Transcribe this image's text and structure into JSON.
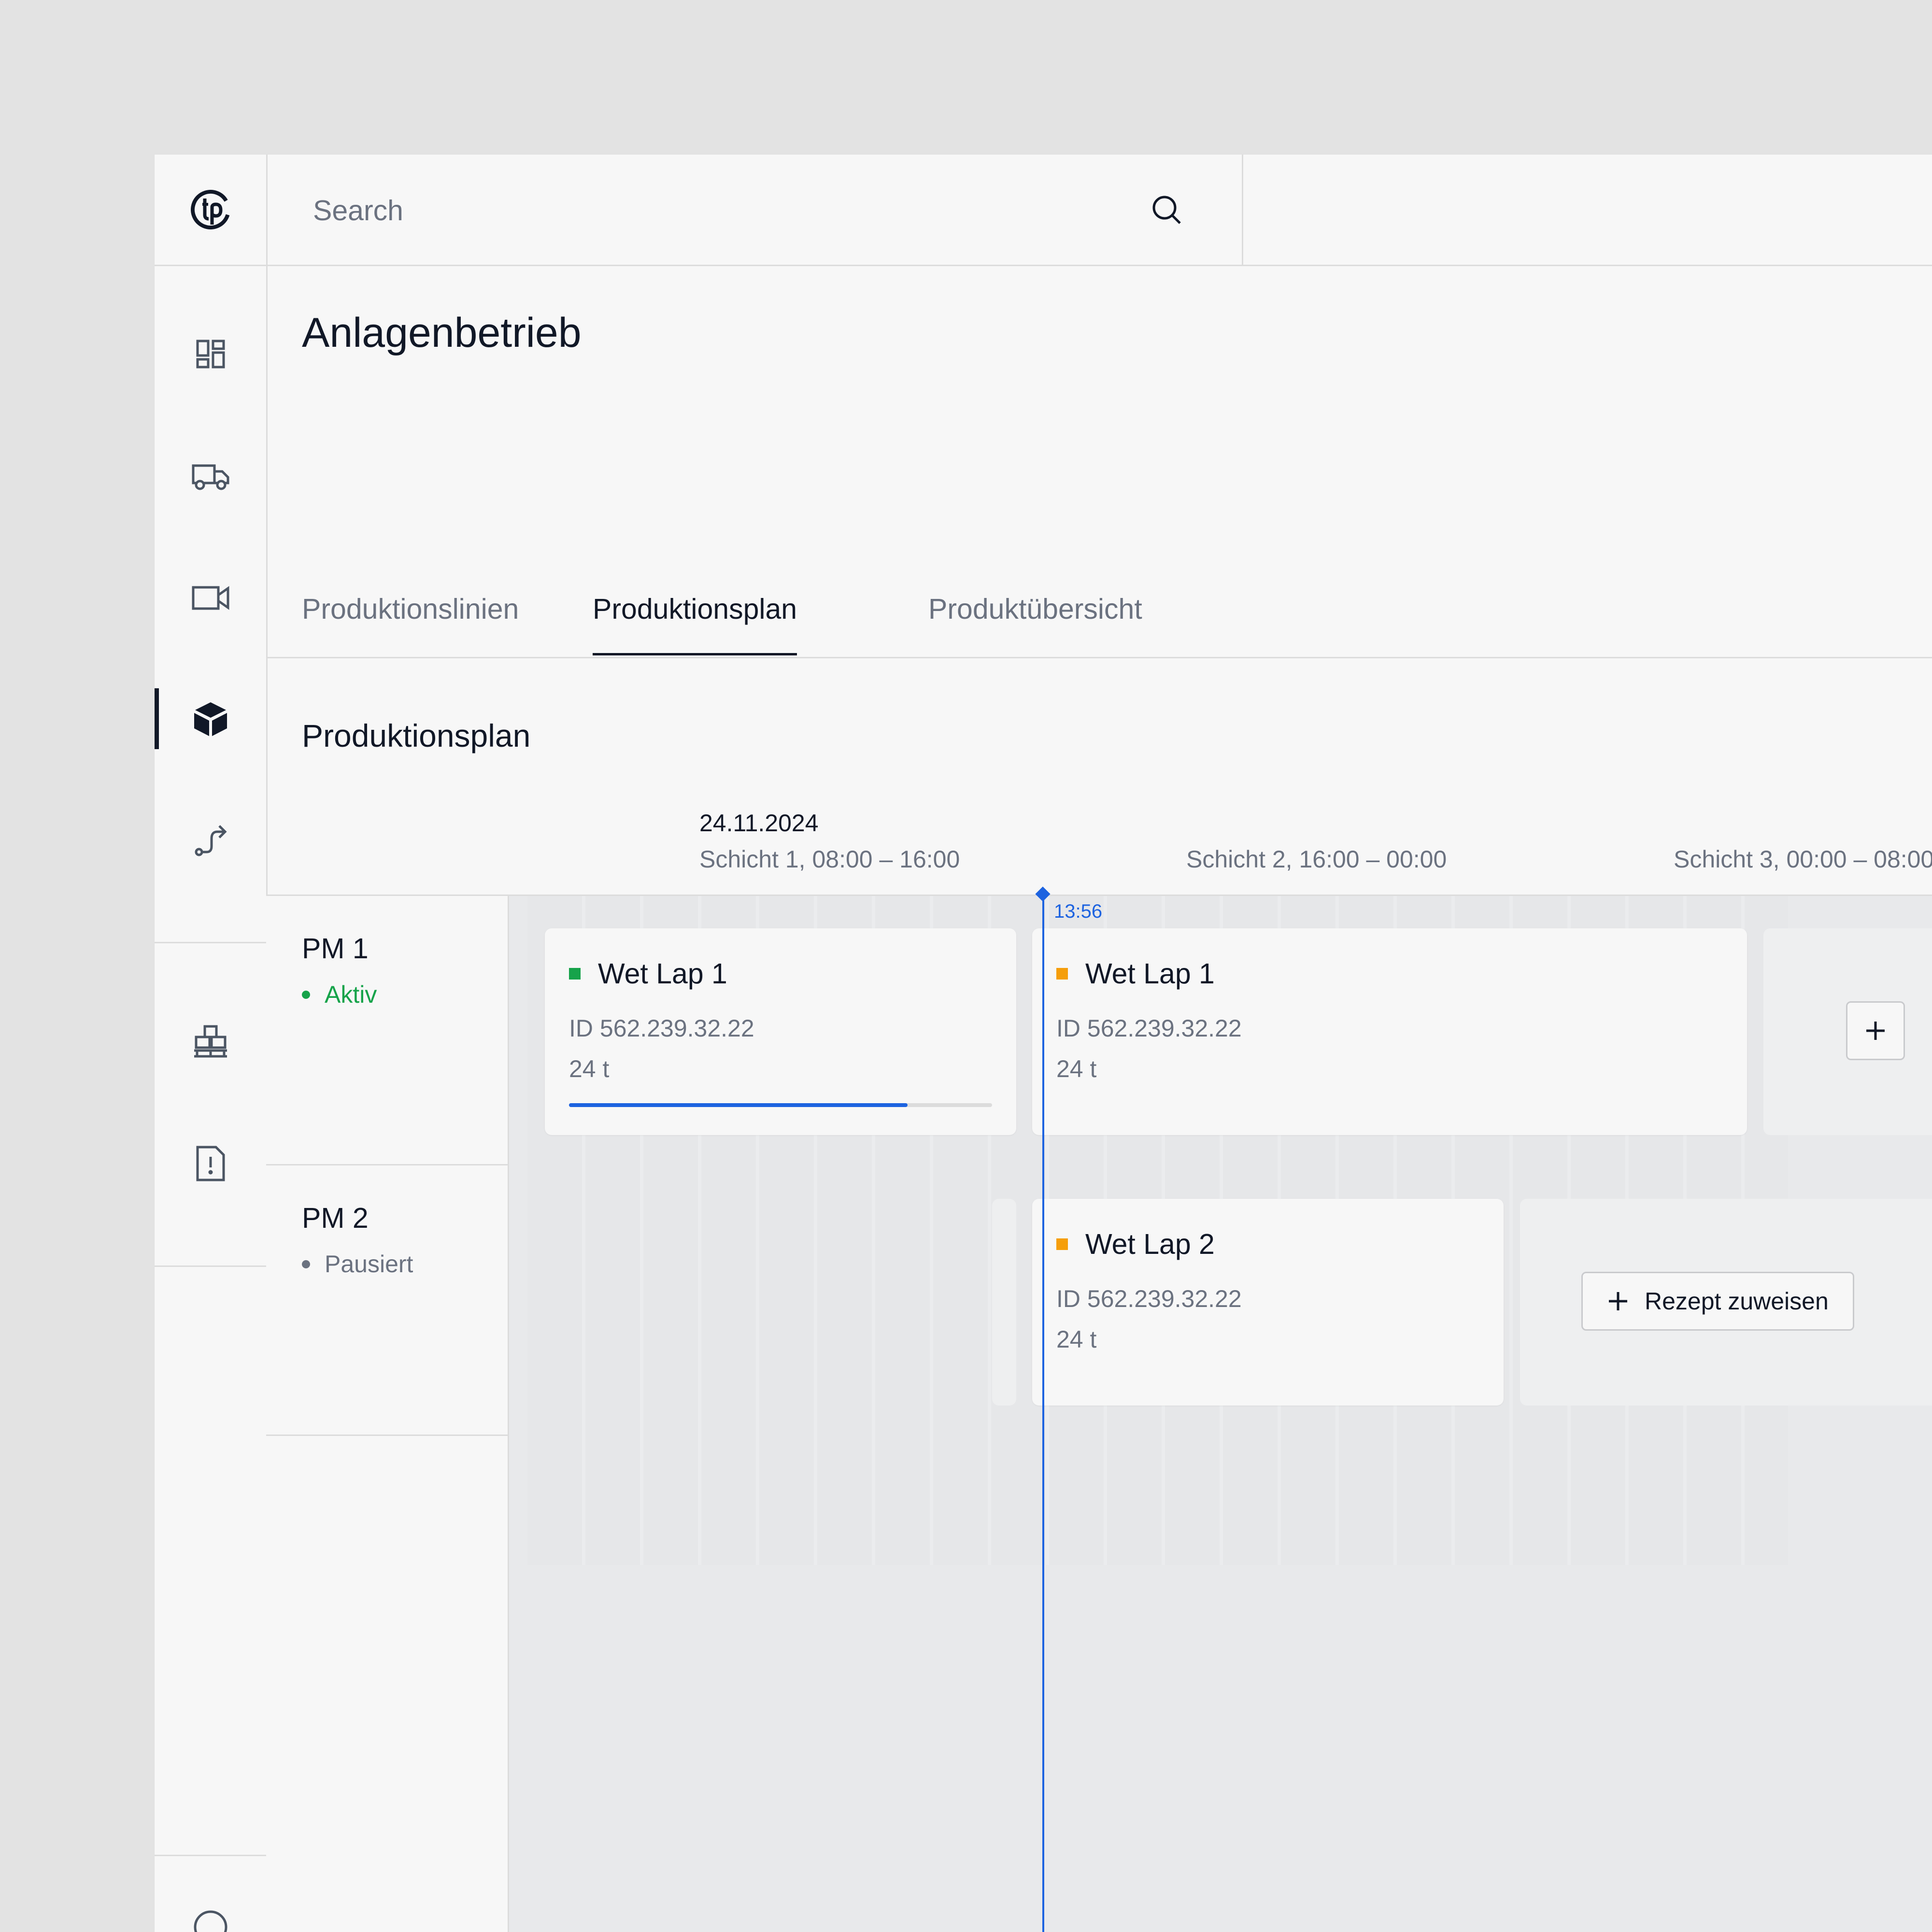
{
  "search": {
    "placeholder": "Search"
  },
  "page": {
    "title": "Anlagenbetrieb"
  },
  "tabs": [
    {
      "label": "Produktionslinien",
      "active": false
    },
    {
      "label": "Produktionsplan",
      "active": true
    },
    {
      "label": "Produktübersicht",
      "active": false
    }
  ],
  "section": {
    "title": "Produktionsplan"
  },
  "timeline": {
    "date": "24.11.2024",
    "shifts": [
      "Schicht 1, 08:00 – 16:00",
      "Schicht 2, 16:00 – 00:00",
      "Schicht 3, 00:00 – 08:00"
    ],
    "now": "13:56"
  },
  "lines": [
    {
      "name": "PM 1",
      "status": "Aktiv",
      "status_color": "#16a34a"
    },
    {
      "name": "PM 2",
      "status": "Pausiert",
      "status_color": "#6b7280"
    }
  ],
  "jobs": [
    {
      "name": "Wet Lap 1",
      "id": "ID 562.239.32.22",
      "qty": "24 t",
      "color": "#16a34a",
      "progress": 0.8
    },
    {
      "name": "Wet Lap 1",
      "id": "ID 562.239.32.22",
      "qty": "24 t",
      "color": "#f59e0b"
    },
    {
      "name": "Wet Lap 2",
      "id": "ID 562.239.32.22",
      "qty": "24 t",
      "color": "#f59e0b"
    }
  ],
  "actions": {
    "assign_recipe": "Rezept zuweisen"
  },
  "icons": [
    "logo-icon",
    "dashboard-icon",
    "truck-icon",
    "video-icon",
    "cube-icon",
    "route-icon",
    "pallet-icon",
    "report-icon",
    "search-icon",
    "plus-icon"
  ],
  "colors": {
    "accent": "#1d63e0",
    "active": "#16a34a",
    "scheduled": "#f59e0b"
  }
}
